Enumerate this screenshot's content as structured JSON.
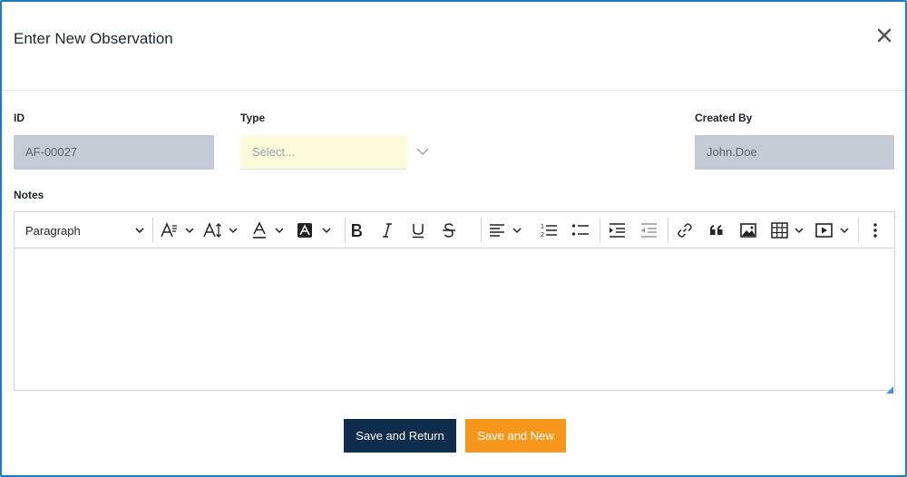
{
  "modal": {
    "title": "Enter New Observation"
  },
  "form": {
    "id_label": "ID",
    "id_value": "AF-00027",
    "type_label": "Type",
    "type_placeholder": "Select...",
    "created_by_label": "Created By",
    "created_by_value": "John.Doe",
    "notes_label": "Notes"
  },
  "editor": {
    "paragraph_style": "Paragraph",
    "content": ""
  },
  "actions": {
    "save_return_label": "Save and Return",
    "save_new_label": "Save and New"
  },
  "colors": {
    "accent_border": "#1c7ec0",
    "primary_button": "#0e2c4c",
    "secondary_button": "#f7981d",
    "readonly_field": "#c3cbd4",
    "required_field": "#fdfbd9"
  }
}
